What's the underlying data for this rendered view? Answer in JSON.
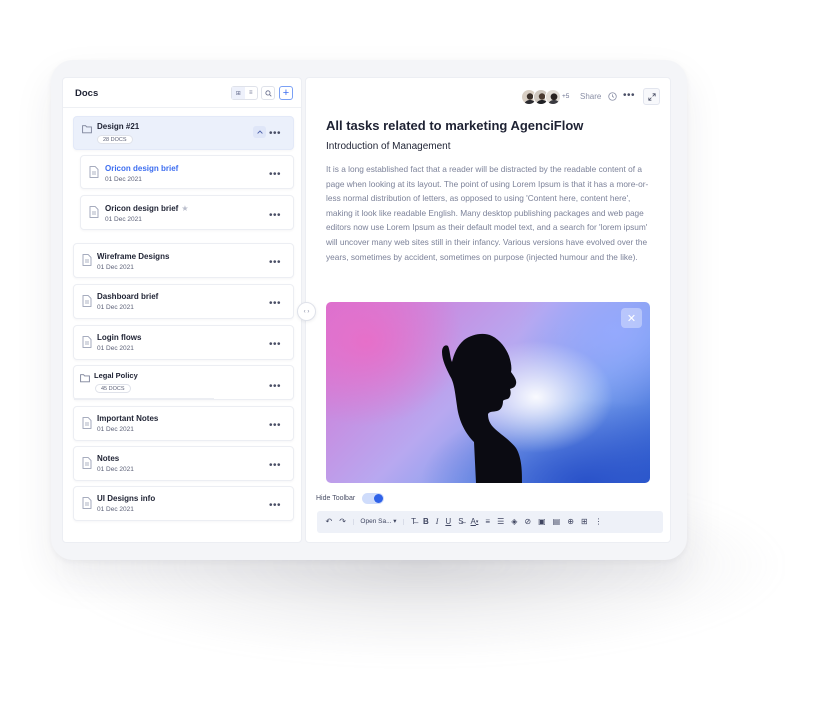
{
  "sidebar": {
    "title": "Docs",
    "items": [
      {
        "title": "Design #21",
        "badge": "28 DOCS",
        "type": "folder",
        "expanded": true
      },
      {
        "title": "Oricon design brief",
        "date": "01 Dec 2021",
        "type": "doc",
        "active": true
      },
      {
        "title": "Oricon design brief",
        "date": "01 Dec 2021",
        "type": "doc",
        "starred": true
      },
      {
        "title": "Wireframe Designs",
        "date": "01 Dec 2021",
        "type": "doc"
      },
      {
        "title": "Dashboard brief",
        "date": "01 Dec 2021",
        "type": "doc"
      },
      {
        "title": "Login flows",
        "date": "01 Dec 2021",
        "type": "doc"
      },
      {
        "title": "Legal Policy",
        "badge": "45 DOCS",
        "type": "folder"
      },
      {
        "title": "Important Notes",
        "date": "01 Dec 2021",
        "type": "doc"
      },
      {
        "title": "Notes",
        "date": "01 Dec 2021",
        "type": "doc"
      },
      {
        "title": "UI Designs info",
        "date": "01 Dec 2021",
        "type": "doc"
      }
    ],
    "more_label": "•••"
  },
  "header": {
    "avatar_extra": "+5",
    "share_label": "Share",
    "more_label": "•••"
  },
  "document": {
    "title": "All tasks related to marketing AgenciFlow",
    "subtitle": "Introduction of Management",
    "body": "It is a long established fact that a reader will be distracted by the readable content of a page when looking at its layout. The point of using Lorem Ipsum is that it has a more-or-less normal distribution of letters, as opposed to using 'Content here, content here', making it look like readable English. Many desktop publishing packages and web page editors now use Lorem Ipsum as their default model text, and a search for 'lorem ipsum' will uncover many web sites still in their infancy. Various versions have evolved over the years, sometimes by accident, sometimes on purpose (injected humour and the like)."
  },
  "toolbar": {
    "hide_label": "Hide Toolbar",
    "hide_on": true,
    "font_label": "Open Sa... ▾",
    "bold": "B",
    "italic": "I",
    "underline": "U",
    "text_color": "A"
  },
  "colors": {
    "accent": "#3c6df0",
    "toggle": "#2f62e8"
  }
}
